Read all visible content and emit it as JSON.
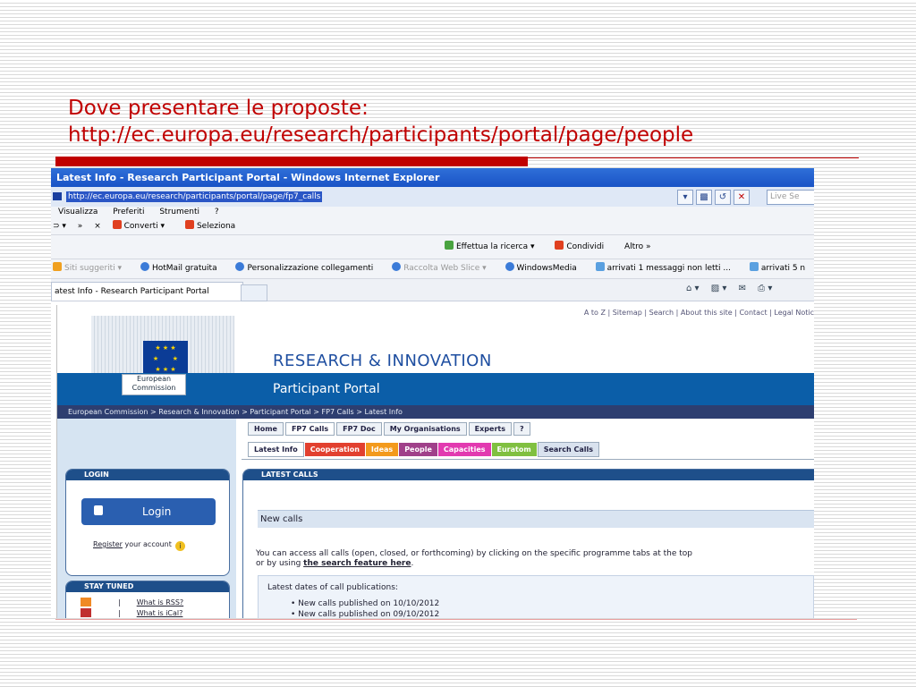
{
  "slide": {
    "title_line1": "Dove presentare le proposte:",
    "title_line2": "http://ec.europa.eu/research/participants/portal/page/people",
    "accent": "#c00000"
  },
  "browser": {
    "window_title": "Latest Info - Research Participant Portal - Windows Internet Explorer",
    "address": "http://ec.europa.eu/research/participants/portal/page/fp7_calls",
    "live_search_placeholder": "Live Se",
    "menu": [
      "Visualizza",
      "Preferiti",
      "Strumenti",
      "?"
    ],
    "toolbar1": {
      "back": "⊃ ▾",
      "more": "»",
      "close": "×",
      "converti": "Converti ▾",
      "seleziona": "Seleziona"
    },
    "toolbar2": {
      "search": "Effettua la ricerca ▾",
      "share": "Condividi",
      "more": "Altro »"
    },
    "favorites": {
      "suggested": "Siti suggeriti ▾",
      "hotmail": "HotMail gratuita",
      "custom": "Personalizzazione collegamenti",
      "webslice": "Raccolta Web Slice ▾",
      "wmedia": "WindowsMedia",
      "msg1": "arrivati 1 messaggi non letti ...",
      "msg2": "arrivati 5 n"
    },
    "tab_label": "atest Info - Research Participant Portal",
    "cmd_icons": {
      "home": "⌂ ▾",
      "feeds": "▨ ▾",
      "mail": "✉",
      "print": "⎙ ▾"
    }
  },
  "page": {
    "top_links": "A to Z | Sitemap | Search | About this site | Contact | Legal Notic",
    "ec_label_1": "European",
    "ec_label_2": "Commission",
    "flag_stars": "★ ★ ★\n★       ★\n★ ★ ★",
    "ri_title": "RESEARCH & INNOVATION",
    "portal_title": "Participant Portal",
    "breadcrumb": "European Commission > Research & Innovation > Participant Portal > FP7 Calls > Latest Info",
    "nav_tabs": [
      "Home",
      "FP7 Calls",
      "FP7 Doc",
      "My Organisations",
      "Experts",
      "?"
    ],
    "sub_tabs": [
      "Latest Info",
      "Cooperation",
      "Ideas",
      "People",
      "Capacities",
      "Euratom",
      "Search Calls"
    ],
    "login_head": "LOGIN",
    "login_button": "Login",
    "register_link": "Register",
    "register_rest": " your account",
    "stay_head": "STAY TUNED",
    "rss_link": "What is RSS?",
    "ical_link": "What is iCal?",
    "latest_head": "LATEST CALLS",
    "new_calls": "New calls",
    "para_1": "You can access all calls (open, closed, or forthcoming) by clicking on the specific programme tabs at the top",
    "para_2a": "or by using ",
    "para_2b": "the search feature here",
    "para_2c": ".",
    "dates_head": "Latest dates of call publications:",
    "date_1": "•   New calls published on 10/10/2012",
    "date_2": "•   New calls published on 09/10/2012"
  }
}
